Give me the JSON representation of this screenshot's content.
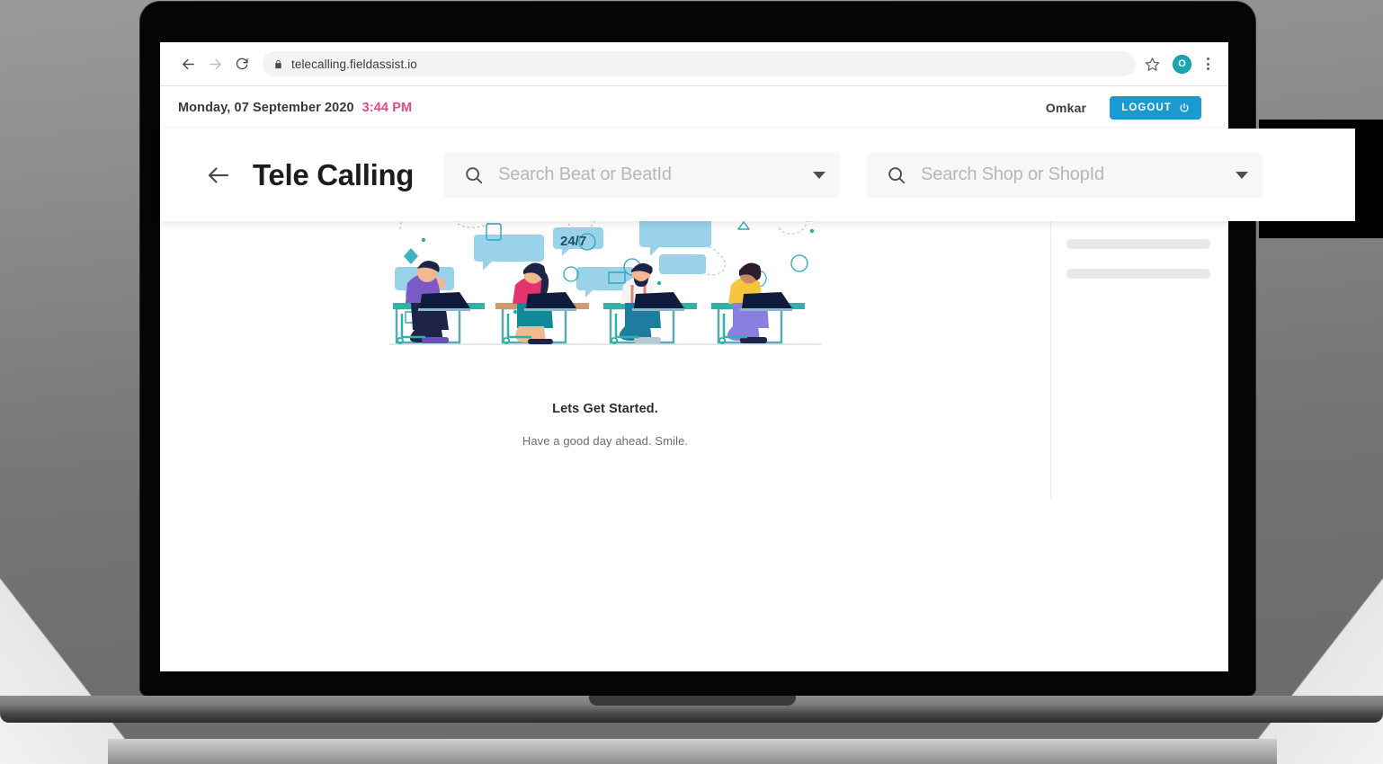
{
  "browser": {
    "back_icon": "arrow-left-icon",
    "forward_icon": "arrow-right-icon",
    "reload_icon": "reload-icon",
    "lock_icon": "lock-icon",
    "url": "telecalling.fieldassist.io",
    "bookmark_icon": "star-icon",
    "profile_initial": "O",
    "menu_icon": "kebab-menu-icon"
  },
  "topbar": {
    "date": "Monday, 07 September 2020",
    "time": "3:44 PM",
    "time_color": "#e8467c",
    "username": "Omkar",
    "logout_label": "LOGOUT",
    "logout_icon": "power-icon",
    "logout_color": "#1b9ad1"
  },
  "header": {
    "back_icon": "arrow-left-icon",
    "title": "Tele Calling",
    "search_beat": {
      "icon": "search-icon",
      "placeholder": "Search Beat or BeatId",
      "value": "",
      "caret_icon": "chevron-down-icon"
    },
    "search_shop": {
      "icon": "search-icon",
      "placeholder": "Search Shop or ShopId",
      "value": "",
      "caret_icon": "chevron-down-icon"
    }
  },
  "main": {
    "illustration_name": "call-center-agents-illustration",
    "illustration_badge": "24/7",
    "headline": "Lets Get Started.",
    "subline": "Have a good day ahead. Smile."
  },
  "sidebar": {
    "skeleton_count": 4,
    "skeleton_color": "#e8e8e8"
  },
  "theme": {
    "accent": "#1b9ad1",
    "avatar": "#19a7b5",
    "illustration_blue": "#8ecbe8",
    "illustration_teal": "#2fb3a8"
  }
}
